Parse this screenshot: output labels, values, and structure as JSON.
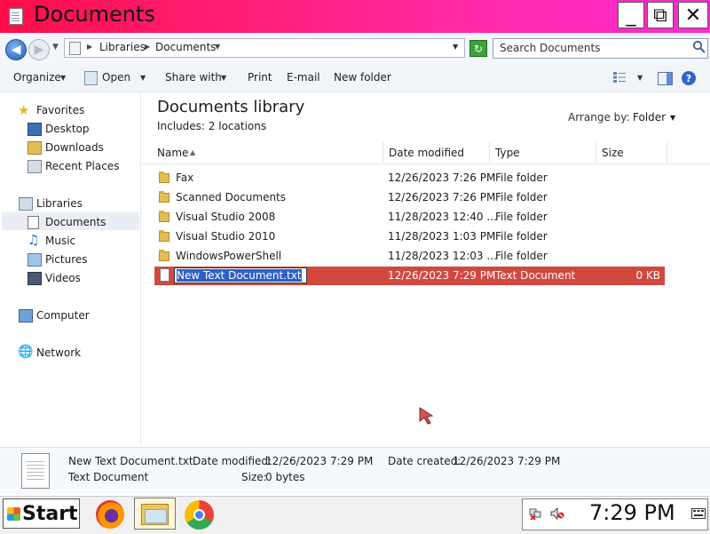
{
  "window": {
    "title": "Documents",
    "minimize_glyph": "_",
    "maximize_glyph": "⧉",
    "close_glyph": "✕"
  },
  "address": {
    "breadcrumbs": [
      "Libraries",
      "Documents"
    ],
    "search_placeholder": "Search Documents"
  },
  "toolbar": {
    "organize": "Organize",
    "open": "Open",
    "share_with": "Share with",
    "print": "Print",
    "email": "E-mail",
    "new_folder": "New folder"
  },
  "nav": {
    "favorites": "Favorites",
    "desktop": "Desktop",
    "downloads": "Downloads",
    "recent_places": "Recent Places",
    "libraries": "Libraries",
    "documents": "Documents",
    "music": "Music",
    "pictures": "Pictures",
    "videos": "Videos",
    "computer": "Computer",
    "network": "Network"
  },
  "library": {
    "title": "Documents library",
    "includes": "Includes:  2 locations",
    "arrange_label": "Arrange by:",
    "arrange_value": "Folder"
  },
  "columns": {
    "name": "Name",
    "date_modified": "Date modified",
    "type": "Type",
    "size": "Size"
  },
  "files": [
    {
      "name": "Fax",
      "date": "12/26/2023 7:26 PM",
      "type": "File folder",
      "size": ""
    },
    {
      "name": "Scanned Documents",
      "date": "12/26/2023 7:26 PM",
      "type": "File folder",
      "size": ""
    },
    {
      "name": "Visual Studio 2008",
      "date": "11/28/2023 12:40 ...",
      "type": "File folder",
      "size": ""
    },
    {
      "name": "Visual Studio 2010",
      "date": "11/28/2023 1:03 PM",
      "type": "File folder",
      "size": ""
    },
    {
      "name": "WindowsPowerShell",
      "date": "11/28/2023 12:03 ...",
      "type": "File folder",
      "size": ""
    },
    {
      "name": "New Text Document.txt",
      "date": "12/26/2023 7:29 PM",
      "type": "Text Document",
      "size": "0 KB"
    }
  ],
  "details": {
    "name": "New Text Document.txt",
    "modified_label": "Date modified:",
    "modified_value": "12/26/2023 7:29 PM",
    "created_label": "Date created:",
    "created_value": "12/26/2023 7:29 PM",
    "type": "Text Document",
    "size_label": "Size:",
    "size_value": "0 bytes"
  },
  "taskbar": {
    "start": "Start",
    "clock": "7:29 PM"
  },
  "colors": {
    "title_gradient_start": "#ff0d4a",
    "title_gradient_end": "#ff2bd2",
    "selection": "#d2483f",
    "rename_highlight": "#2f60c8"
  }
}
